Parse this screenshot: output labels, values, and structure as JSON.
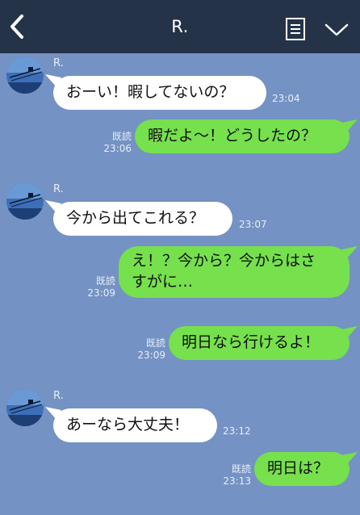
{
  "header": {
    "title": "R.",
    "back_icon": "chevron-left-icon",
    "menu_icon": "list-icon",
    "collapse_icon": "chevron-down-icon"
  },
  "colors": {
    "header_bg": "#253348",
    "chat_bg": "#7492c3",
    "incoming_bubble": "#ffffff",
    "outgoing_bubble": "#76e04d"
  },
  "messages": [
    {
      "dir": "in",
      "sender": "R.",
      "text": "おーい！暇してないの？",
      "time": "23:04"
    },
    {
      "dir": "out",
      "text": "暇だよ〜！どうしたの？",
      "read": "既読",
      "time": "23:06"
    },
    {
      "dir": "in",
      "sender": "R.",
      "text": "今から出てこれる？",
      "time": "23:07"
    },
    {
      "dir": "out",
      "text_line1": "え！？今から？今からはさ",
      "text_line2": "すがに…",
      "read": "既読",
      "time": "23:09"
    },
    {
      "dir": "out",
      "text": "明日なら行けるよ！",
      "read": "既読",
      "time": "23:09"
    },
    {
      "dir": "in",
      "sender": "R.",
      "text": "あーなら大丈夫！",
      "time": "23:12"
    },
    {
      "dir": "out",
      "text": "明日は？",
      "read": "既読",
      "time": "23:13"
    }
  ]
}
